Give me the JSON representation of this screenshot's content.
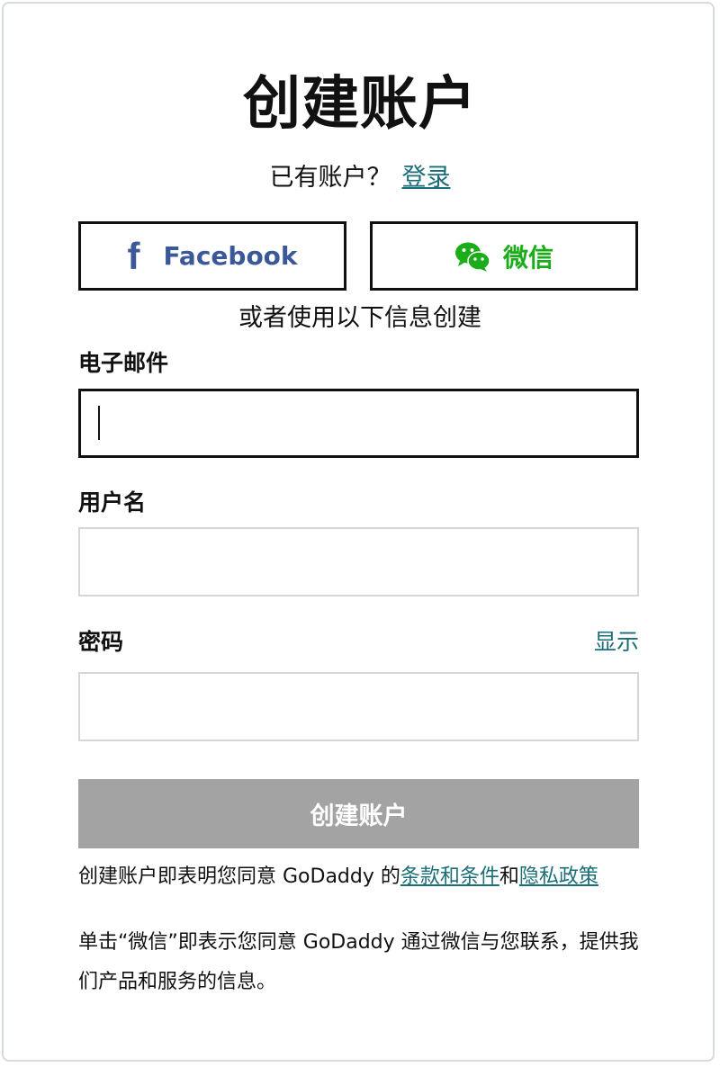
{
  "page": {
    "title": "创建账户",
    "have_account_text": "已有账户？",
    "signin_link": "登录"
  },
  "social": {
    "facebook_label": "Facebook",
    "facebook_icon": "facebook-f-icon",
    "wechat_label": "微信",
    "wechat_icon": "wechat-icon"
  },
  "or_text": "或者使用以下信息创建",
  "form": {
    "email_label": "电子邮件",
    "email_value": "",
    "username_label": "用户名",
    "username_value": "",
    "password_label": "密码",
    "password_value": "",
    "show_password_label": "显示",
    "submit_label": "创建账户"
  },
  "legal": {
    "terms_prefix": "创建账户即表明您同意 GoDaddy 的",
    "terms_link": "条款和条件",
    "and_text": "和",
    "privacy_link": "隐私政策",
    "wechat_consent": "单击“微信”即表示您同意 GoDaddy 通过微信与您联系，提供我们产品和服务的信息。"
  },
  "colors": {
    "link": "#1b6e78",
    "facebook": "#3b5998",
    "wechat": "#1aad19",
    "submit_disabled": "#a3a3a3"
  }
}
